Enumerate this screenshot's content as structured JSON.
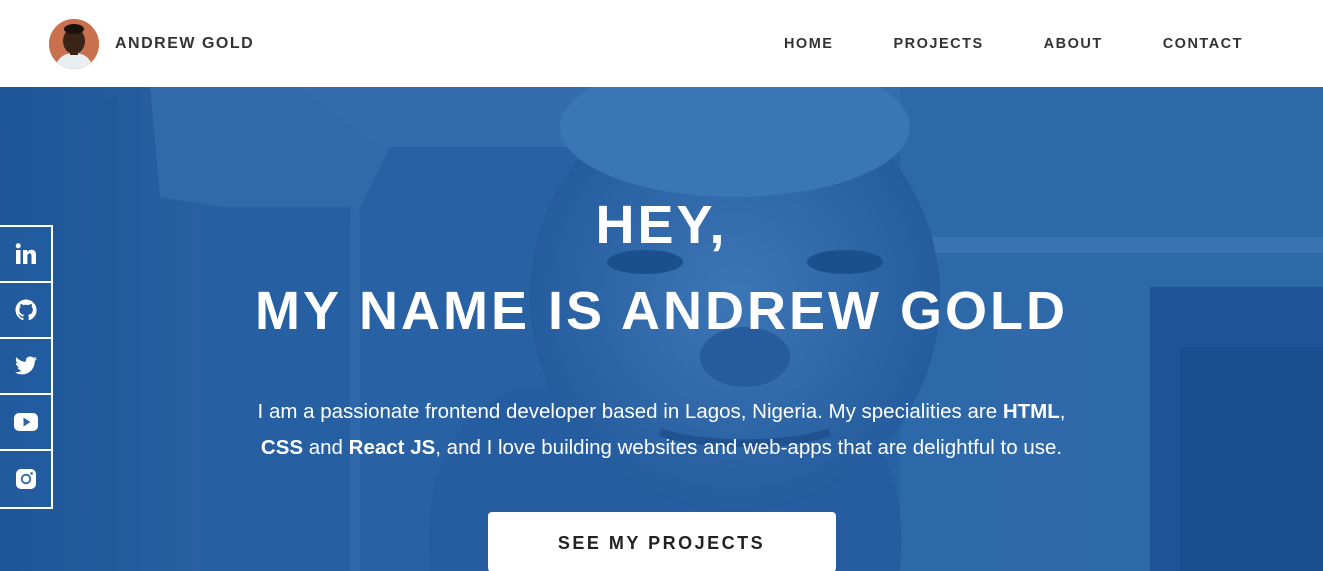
{
  "header": {
    "brand_name": "ANDREW GOLD",
    "nav": [
      {
        "label": "HOME"
      },
      {
        "label": "PROJECTS"
      },
      {
        "label": "ABOUT"
      },
      {
        "label": "CONTACT"
      }
    ]
  },
  "hero": {
    "title_line1": "HEY,",
    "title_line2": "MY NAME IS ANDREW GOLD",
    "desc": {
      "part1": "I am a passionate frontend developer based in Lagos, Nigeria. My specialities are ",
      "html": "HTML",
      "comma": ",",
      "css": "CSS",
      "and": " and ",
      "react": "React JS",
      "part2": ", and I love building websites and web-apps that are delightful to use."
    },
    "cta_label": "SEE MY PROJECTS"
  },
  "social": [
    {
      "icon": "linkedin-icon"
    },
    {
      "icon": "github-icon"
    },
    {
      "icon": "twitter-icon"
    },
    {
      "icon": "youtube-icon"
    },
    {
      "icon": "instagram-icon"
    }
  ],
  "colors": {
    "hero_tint": "#2f67a6",
    "text_dark": "#333333",
    "white": "#ffffff"
  }
}
